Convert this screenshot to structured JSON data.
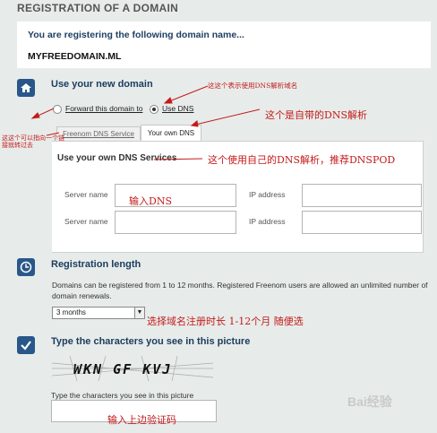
{
  "page": {
    "title": "REGISTRATION OF A DOMAIN"
  },
  "banner": {
    "line1": "You are registering the following domain name...",
    "domain": "MYFREEDOMAIN.ML"
  },
  "section_new_domain": {
    "icon": "home-icon",
    "title": "Use your new domain",
    "options": [
      {
        "label": "Forward this domain to",
        "selected": false
      },
      {
        "label": "Use DNS",
        "selected": true
      }
    ],
    "tabs": [
      {
        "label": "Freenom DNS Service",
        "active": false
      },
      {
        "label": "Your own DNS",
        "active": true
      }
    ]
  },
  "dns_panel": {
    "title": "Use your own DNS Services",
    "rows": [
      {
        "server_label": "Server name",
        "ip_label": "IP address"
      },
      {
        "server_label": "Server name",
        "ip_label": "IP address"
      }
    ]
  },
  "section_length": {
    "icon": "clock-icon",
    "title": "Registration length",
    "description": "Domains can be registered from 1 to 12 months. Registered Freenom users are allowed an unlimited number of domain renewals.",
    "selected": "3 months"
  },
  "section_captcha": {
    "icon": "checkmark-icon",
    "title": "Type the characters you see in this picture",
    "captcha_text": "WKN GF KVJ",
    "input_label": "Type the characters you see in this picture"
  },
  "annotations": {
    "use_dns": "这这个表示使用DNS解析域名",
    "forward": "这这个可以指向一个链接就转过去",
    "freenom_dns": "这个是自带的DNS解析",
    "own_dns": "这个使用自己的DNS解析，推荐DNSPOD",
    "input_dns": "输入DNS",
    "length": "选择域名注册时长 1-12个月 随便选",
    "captcha": "输入上边验证码"
  },
  "watermark": "Bai经验",
  "colors": {
    "background": "#e7ecea",
    "accent": "#29578a",
    "annotation": "#c41a1a"
  }
}
